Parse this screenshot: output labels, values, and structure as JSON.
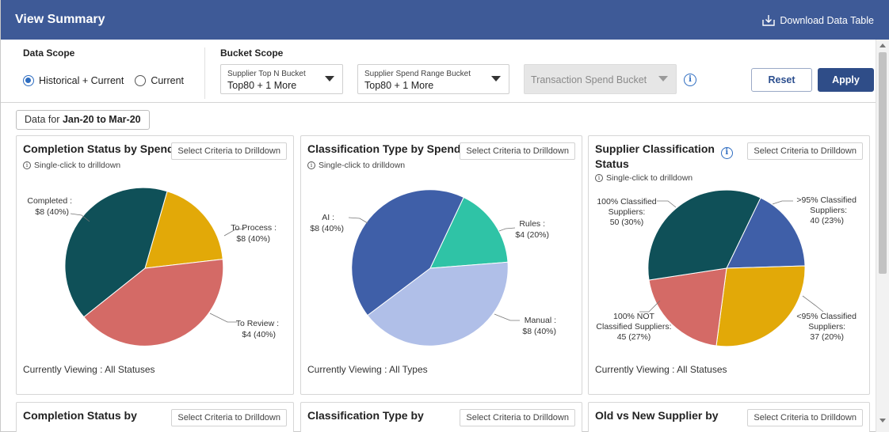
{
  "header": {
    "title": "View Summary",
    "download_label": "Download Data Table"
  },
  "filters": {
    "data_scope_label": "Data Scope",
    "bucket_scope_label": "Bucket Scope",
    "radio_historical": "Historical + Current",
    "radio_current": "Current",
    "dd1": {
      "label": "Supplier Top N Bucket",
      "value": "Top80 + 1 More"
    },
    "dd2": {
      "label": "Supplier Spend Range Bucket",
      "value": "Top80 + 1 More"
    },
    "dd3": {
      "value": "Transaction Spend Bucket"
    },
    "reset": "Reset",
    "apply": "Apply"
  },
  "date_chip": {
    "prefix": "Data for",
    "range": "Jan-20 to Mar-20"
  },
  "cards": [
    {
      "title": "Completion Status by Spend",
      "drill": "Select Criteria to Drilldown",
      "hint": "Single-click to drilldown",
      "viewing": "Currently Viewing : All Statuses",
      "labels": {
        "a1": "Completed :",
        "a2": "$8 (40%)",
        "b1": "To Process :",
        "b2": "$8 (40%)",
        "c1": "To Review :",
        "c2": "$4 (40%)"
      }
    },
    {
      "title": "Classification Type by Spend",
      "drill": "Select Criteria to Drilldown",
      "hint": "Single-click to drilldown",
      "viewing": "Currently Viewing : All Types",
      "labels": {
        "a1": "AI :",
        "a2": "$8 (40%)",
        "b1": "Rules :",
        "b2": "$4 (20%)",
        "c1": "Manual :",
        "c2": "$8 (40%)"
      }
    },
    {
      "title_line1": "Supplier Classification",
      "title_line2": "Status",
      "drill": "Select Criteria to Drilldown",
      "hint": "Single-click to drilldown",
      "viewing": "Currently Viewing : All Statuses",
      "labels": {
        "a1": "100% Classified",
        "a2": "Suppliers:",
        "a3": "50 (30%)",
        "b1": ">95% Classified",
        "b2": "Suppliers:",
        "b3": "40 (23%)",
        "c1": "100% NOT",
        "c2": "Classified Suppliers:",
        "c3": "45 (27%)",
        "d1": "<95% Classified",
        "d2": "Suppliers:",
        "d3": "37 (20%)"
      }
    }
  ],
  "bottom_cards": [
    {
      "title": "Completion Status by",
      "drill": "Select Criteria to Drilldown"
    },
    {
      "title": "Classification Type by",
      "drill": "Select Criteria to Drilldown"
    },
    {
      "title": "Old vs New Supplier by",
      "drill": "Select Criteria to Drilldown"
    }
  ],
  "colors": {
    "header": "#3e5a97",
    "teal_dark": "#0f5058",
    "gold": "#e2a908",
    "salmon": "#d46a66",
    "blue": "#3f5fa8",
    "mint": "#2fc3a6",
    "lavender": "#b0bfe8"
  }
}
